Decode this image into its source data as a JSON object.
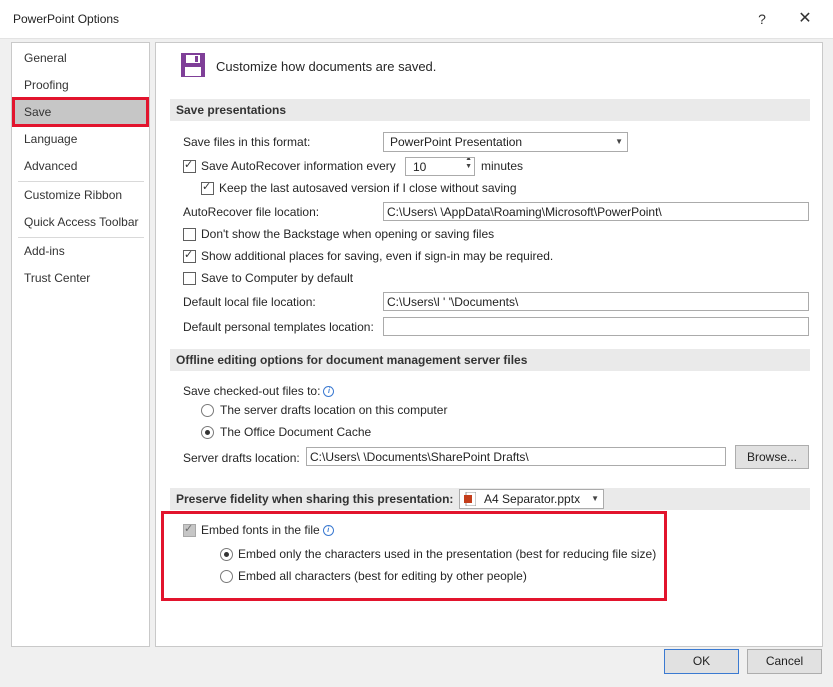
{
  "window": {
    "title": "PowerPoint Options",
    "help": "?",
    "close": "✕"
  },
  "nav": {
    "items": [
      {
        "label": "General"
      },
      {
        "label": "Proofing"
      },
      {
        "label": "Save"
      },
      {
        "label": "Language"
      },
      {
        "label": "Advanced"
      },
      {
        "label": "Customize Ribbon"
      },
      {
        "label": "Quick Access Toolbar"
      },
      {
        "label": "Add-ins"
      },
      {
        "label": "Trust Center"
      }
    ],
    "selected": "Save"
  },
  "page": {
    "heading": "Customize how documents are saved."
  },
  "save_presentations": {
    "header": "Save presentations",
    "format_label": "Save files in this format:",
    "format_value": "PowerPoint Presentation",
    "autorecover_label": "Save AutoRecover information every",
    "autorecover_minutes": "10",
    "minutes_label": "minutes",
    "keep_last_label": "Keep the last autosaved version if I close without saving",
    "autorecover_location_label": "AutoRecover file location:",
    "autorecover_location_value": "C:\\Users\\             \\AppData\\Roaming\\Microsoft\\PowerPoint\\",
    "no_backstage_label": "Don't show the Backstage when opening or saving files",
    "additional_places_label": "Show additional places for saving, even if sign-in may be required.",
    "save_to_computer_label": "Save to Computer by default",
    "default_local_label": "Default local file location:",
    "default_local_value": "C:\\Users\\l   '         '\\Documents\\",
    "default_templates_label": "Default personal templates location:",
    "default_templates_value": ""
  },
  "offline": {
    "header": "Offline editing options for document management server files",
    "checked_out_label": "Save checked-out files to:",
    "server_drafts_option": "The server drafts location on this computer",
    "doc_cache_option": "The Office Document Cache",
    "server_drafts_label": "Server drafts location:",
    "server_drafts_value": "C:\\Users\\             \\Documents\\SharePoint Drafts\\",
    "browse_label": "Browse..."
  },
  "fidelity": {
    "header": "Preserve fidelity when sharing this presentation:",
    "file_value": "A4 Separator.pptx",
    "embed_fonts_label": "Embed fonts in the file",
    "embed_only_label": "Embed only the characters used in the presentation (best for reducing file size)",
    "embed_all_label": "Embed all characters (best for editing by other people)"
  },
  "footer": {
    "ok": "OK",
    "cancel": "Cancel"
  },
  "colors": {
    "highlight_red": "#e2142d",
    "accent_purple": "#7f3f98"
  }
}
